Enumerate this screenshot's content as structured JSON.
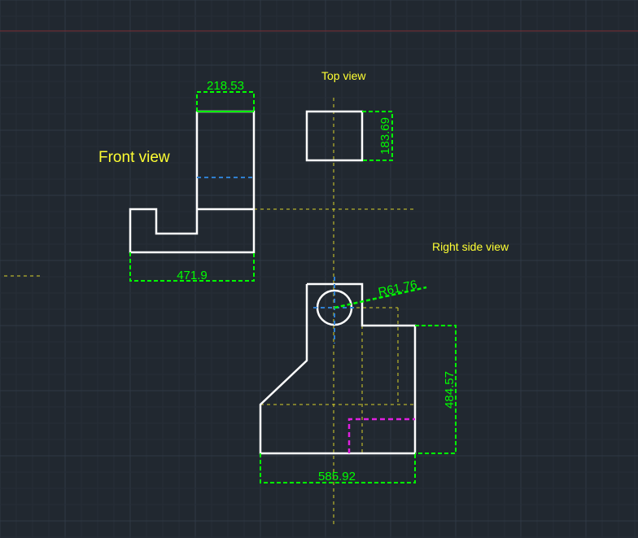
{
  "colors": {
    "background": "#212830",
    "grid_major": "#2f3945",
    "grid_minor": "#262e37",
    "axis_red": "#7a2e33",
    "geometry": "#ffffff",
    "dimension": "#00ff00",
    "centerline": "#d9d22a",
    "hidden_blue": "#2f7fd0",
    "hidden_magenta": "#e020e0",
    "view_label": "#ffff33"
  },
  "labels": {
    "front_view": "Front view",
    "top_view": "Top view",
    "right_side_view": "Right side view"
  },
  "dimensions": {
    "front_width_top": "218.53",
    "front_width_bottom": "471.9",
    "top_height": "183.69",
    "right_radius": "R61.76",
    "right_height": "484.57",
    "right_width": "585.92"
  },
  "icons": {
    "canvas": "cad-drawing-canvas"
  }
}
